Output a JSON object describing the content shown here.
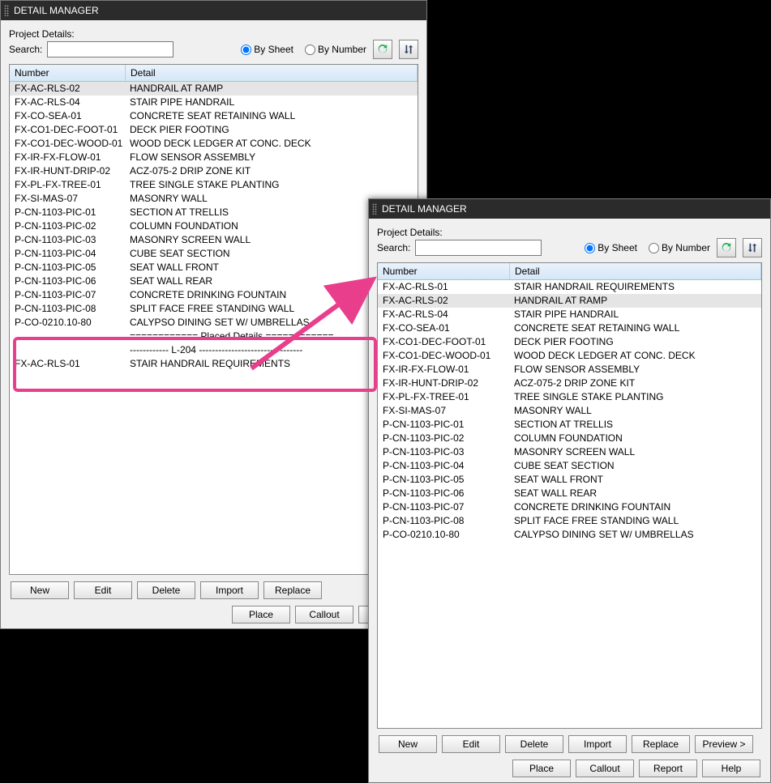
{
  "title": "DETAIL MANAGER",
  "labels": {
    "project": "Project Details:",
    "search": "Search:",
    "bysheet": "By Sheet",
    "bynumber": "By Number",
    "col_number": "Number",
    "col_detail": "Detail"
  },
  "buttons": {
    "new": "New",
    "edit": "Edit",
    "delete": "Delete",
    "import": "Import",
    "replace": "Replace",
    "preview": "Preview >",
    "place": "Place",
    "callout": "Callout",
    "report": "Report",
    "help": "Help"
  },
  "left": {
    "rows": [
      {
        "n": "FX-AC-RLS-02",
        "d": "HANDRAIL AT RAMP",
        "sel": true
      },
      {
        "n": "FX-AC-RLS-04",
        "d": "STAIR PIPE HANDRAIL"
      },
      {
        "n": "FX-CO-SEA-01",
        "d": "CONCRETE SEAT RETAINING WALL"
      },
      {
        "n": "FX-CO1-DEC-FOOT-01",
        "d": "DECK PIER FOOTING"
      },
      {
        "n": "FX-CO1-DEC-WOOD-01",
        "d": "WOOD DECK LEDGER AT CONC. DECK"
      },
      {
        "n": "FX-IR-FX-FLOW-01",
        "d": "FLOW SENSOR ASSEMBLY"
      },
      {
        "n": "FX-IR-HUNT-DRIP-02",
        "d": "ACZ-075-2 DRIP ZONE KIT"
      },
      {
        "n": "FX-PL-FX-TREE-01",
        "d": "TREE SINGLE STAKE PLANTING"
      },
      {
        "n": "FX-SI-MAS-07",
        "d": "MASONRY WALL"
      },
      {
        "n": "P-CN-1103-PIC-01",
        "d": "SECTION AT TRELLIS"
      },
      {
        "n": "P-CN-1103-PIC-02",
        "d": "COLUMN FOUNDATION"
      },
      {
        "n": "P-CN-1103-PIC-03",
        "d": "MASONRY SCREEN WALL"
      },
      {
        "n": "P-CN-1103-PIC-04",
        "d": "CUBE SEAT SECTION"
      },
      {
        "n": "P-CN-1103-PIC-05",
        "d": "SEAT WALL FRONT"
      },
      {
        "n": "P-CN-1103-PIC-06",
        "d": "SEAT WALL REAR"
      },
      {
        "n": "P-CN-1103-PIC-07",
        "d": "CONCRETE DRINKING FOUNTAIN"
      },
      {
        "n": "P-CN-1103-PIC-08",
        "d": "SPLIT FACE FREE STANDING WALL"
      },
      {
        "n": "P-CO-0210.10-80",
        "d": "CALYPSO DINING SET W/ UMBRELLAS"
      }
    ],
    "placed_hdr": "============ Placed Details ============",
    "placed_sub": "------------ L-204 --------------------------------",
    "placed": [
      {
        "n": "FX-AC-RLS-01",
        "d": "STAIR HANDRAIL REQUIREMENTS"
      }
    ]
  },
  "right": {
    "rows": [
      {
        "n": "FX-AC-RLS-01",
        "d": "STAIR HANDRAIL REQUIREMENTS"
      },
      {
        "n": "FX-AC-RLS-02",
        "d": "HANDRAIL AT RAMP",
        "sel": true
      },
      {
        "n": "FX-AC-RLS-04",
        "d": "STAIR PIPE HANDRAIL"
      },
      {
        "n": "FX-CO-SEA-01",
        "d": "CONCRETE SEAT RETAINING WALL"
      },
      {
        "n": "FX-CO1-DEC-FOOT-01",
        "d": "DECK PIER FOOTING"
      },
      {
        "n": "FX-CO1-DEC-WOOD-01",
        "d": "WOOD DECK LEDGER AT CONC. DECK"
      },
      {
        "n": "FX-IR-FX-FLOW-01",
        "d": "FLOW SENSOR ASSEMBLY"
      },
      {
        "n": "FX-IR-HUNT-DRIP-02",
        "d": "ACZ-075-2 DRIP ZONE KIT"
      },
      {
        "n": "FX-PL-FX-TREE-01",
        "d": "TREE SINGLE STAKE PLANTING"
      },
      {
        "n": "FX-SI-MAS-07",
        "d": "MASONRY WALL"
      },
      {
        "n": "P-CN-1103-PIC-01",
        "d": "SECTION AT TRELLIS"
      },
      {
        "n": "P-CN-1103-PIC-02",
        "d": "COLUMN FOUNDATION"
      },
      {
        "n": "P-CN-1103-PIC-03",
        "d": "MASONRY SCREEN WALL"
      },
      {
        "n": "P-CN-1103-PIC-04",
        "d": "CUBE SEAT SECTION"
      },
      {
        "n": "P-CN-1103-PIC-05",
        "d": "SEAT WALL FRONT"
      },
      {
        "n": "P-CN-1103-PIC-06",
        "d": "SEAT WALL REAR"
      },
      {
        "n": "P-CN-1103-PIC-07",
        "d": "CONCRETE DRINKING FOUNTAIN"
      },
      {
        "n": "P-CN-1103-PIC-08",
        "d": "SPLIT FACE FREE STANDING WALL"
      },
      {
        "n": "P-CO-0210.10-80",
        "d": "CALYPSO DINING SET W/ UMBRELLAS"
      }
    ]
  }
}
